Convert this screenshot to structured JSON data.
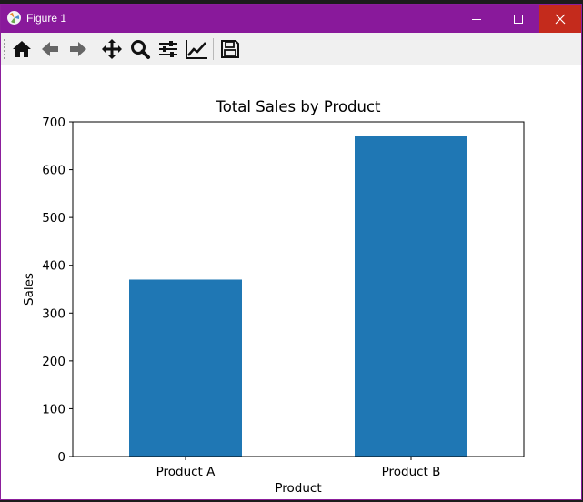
{
  "window": {
    "title": "Figure 1",
    "controls": {
      "minimize": "minimize",
      "maximize": "maximize",
      "close": "close"
    }
  },
  "toolbar": {
    "buttons": [
      {
        "name": "home",
        "icon": "home-icon"
      },
      {
        "name": "back",
        "icon": "arrow-left-icon"
      },
      {
        "name": "forward",
        "icon": "arrow-right-icon"
      },
      {
        "name": "pan",
        "icon": "move-icon"
      },
      {
        "name": "zoom",
        "icon": "magnifier-icon"
      },
      {
        "name": "configure-subplots",
        "icon": "sliders-icon"
      },
      {
        "name": "edit-axis",
        "icon": "line-chart-icon"
      },
      {
        "name": "save",
        "icon": "floppy-disk-icon"
      }
    ]
  },
  "colors": {
    "titlebar": "#89199b",
    "close": "#c42b1c",
    "bar": "#1f77b4"
  },
  "chart_data": {
    "type": "bar",
    "title": "Total Sales by Product",
    "xlabel": "Product",
    "ylabel": "Sales",
    "categories": [
      "Product A",
      "Product B"
    ],
    "values": [
      370,
      670
    ],
    "ylim": [
      0,
      700
    ],
    "yticks": [
      0,
      100,
      200,
      300,
      400,
      500,
      600,
      700
    ],
    "grid": false,
    "legend": null
  }
}
